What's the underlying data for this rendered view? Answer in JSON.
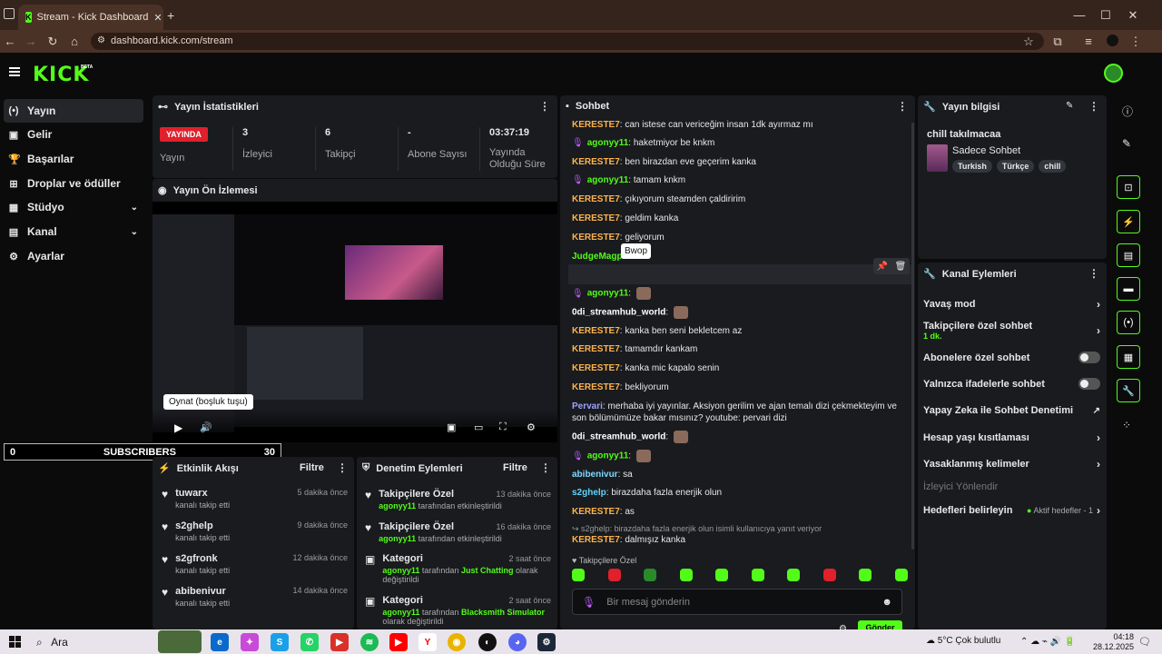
{
  "browser": {
    "tab_title": "Stream - Kick Dashboard",
    "url": "dashboard.kick.com/stream"
  },
  "brand": {
    "logo": "KICK",
    "beta": "BETA",
    "accent": "#53fc18"
  },
  "sidebar": {
    "items": [
      {
        "label": "Yayın",
        "icon": "broadcast-icon"
      },
      {
        "label": "Gelir",
        "icon": "wallet-icon"
      },
      {
        "label": "Başarılar",
        "icon": "trophy-icon"
      },
      {
        "label": "Droplar ve ödüller",
        "icon": "gift-icon"
      },
      {
        "label": "Stüdyo",
        "icon": "studio-icon"
      },
      {
        "label": "Kanal",
        "icon": "channel-icon"
      },
      {
        "label": "Ayarlar",
        "icon": "gear-icon"
      }
    ]
  },
  "stats": {
    "title": "Yayın İstatistikleri",
    "live_badge": "YAYINDA",
    "items": [
      {
        "value": "",
        "label": "Yayın"
      },
      {
        "value": "3",
        "label": "İzleyici"
      },
      {
        "value": "6",
        "label": "Takipçi"
      },
      {
        "value": "-",
        "label": "Abone Sayısı"
      },
      {
        "value": "03:37:19",
        "label": "Yayında Olduğu Süre"
      }
    ]
  },
  "preview": {
    "title": "Yayın Ön İzlemesi",
    "tooltip": "Oynat (boşluk tuşu)"
  },
  "subscribers": {
    "left": "0",
    "label": "SUBSCRIBERS",
    "right": "30"
  },
  "activity": {
    "title": "Etkinlik Akışı",
    "filter": "Filtre",
    "items": [
      {
        "name": "tuwarx",
        "desc": "kanalı takip etti",
        "time": "5 dakika önce"
      },
      {
        "name": "s2ghelp",
        "desc": "kanalı takip etti",
        "time": "9 dakika önce"
      },
      {
        "name": "s2gfronk",
        "desc": "kanalı takip etti",
        "time": "12 dakika önce"
      },
      {
        "name": "abibenivur",
        "desc": "kanalı takip etti",
        "time": "14 dakika önce"
      }
    ]
  },
  "moderation": {
    "title": "Denetim Eylemleri",
    "filter": "Filtre",
    "items": [
      {
        "title": "Takipçilere Özel",
        "user": "agonyy11",
        "rest": "tarafından etkinleştirildi",
        "time": "13 dakika önce"
      },
      {
        "title": "Takipçilere Özel",
        "user": "agonyy11",
        "rest": "tarafından etkinleştirildi",
        "time": "16 dakika önce"
      },
      {
        "title": "Kategori",
        "user": "agonyy11",
        "mid": "tarafından",
        "cat": "Just Chatting",
        "rest": "olarak değiştirildi",
        "time": "2 saat önce"
      },
      {
        "title": "Kategori",
        "user": "agonyy11",
        "mid": "tarafından",
        "cat": "Blacksmith Simulator",
        "rest": "olarak değiştirildi",
        "time": "2 saat önce"
      }
    ]
  },
  "chat": {
    "title": "Sohbet",
    "tooltip": "Bwop",
    "messages": [
      {
        "user": "KERESTE7",
        "cls": "k",
        "text": "can istese can vericeğim insan 1dk ayırmaz mı"
      },
      {
        "user": "agonyy11",
        "cls": "a",
        "mic": true,
        "text": "haketmiyor be knkm"
      },
      {
        "user": "KERESTE7",
        "cls": "k",
        "text": "ben birazdan eve geçerim kanka"
      },
      {
        "user": "agonyy11",
        "cls": "a",
        "mic": true,
        "text": "tamam knkm"
      },
      {
        "user": "KERESTE7",
        "cls": "k",
        "text": "çıkıyorum steamden çaldiririm"
      },
      {
        "user": "KERESTE7",
        "cls": "k",
        "text": "geldim kanka"
      },
      {
        "user": "KERESTE7",
        "cls": "k",
        "text": "geliyorum"
      },
      {
        "user": "JudgeMagpi",
        "cls": "j",
        "text": ""
      },
      {
        "user": "agonyy11",
        "cls": "a",
        "mic": true,
        "text": ""
      },
      {
        "user": "agonyy11",
        "cls": "a",
        "mic": true,
        "text": ""
      },
      {
        "user": "0di_streamhub_world",
        "cls": "o",
        "text": ""
      },
      {
        "user": "KERESTE7",
        "cls": "k",
        "text": "kanka ben seni bekletcem az"
      },
      {
        "user": "KERESTE7",
        "cls": "k",
        "text": "tamamdır kankam"
      },
      {
        "user": "KERESTE7",
        "cls": "k",
        "text": "kanka mic kapalo senin"
      },
      {
        "user": "KERESTE7",
        "cls": "k",
        "text": "bekliyorum"
      },
      {
        "user": "Pervari",
        "cls": "p",
        "text": "merhaba iyi yayınlar. Aksiyon gerilim ve ajan temalı dizi çekmekteyim ve son bölümümüze bakar mısınız? youtube: pervari dizi"
      },
      {
        "user": "0di_streamhub_world",
        "cls": "o",
        "text": ""
      },
      {
        "user": "agonyy11",
        "cls": "a",
        "mic": true,
        "text": ""
      },
      {
        "user": "abibenivur",
        "cls": "ab",
        "text": "sa"
      },
      {
        "user": "s2ghelp",
        "cls": "s",
        "text": "birazdaha fazla enerjik olun"
      },
      {
        "user": "KERESTE7",
        "cls": "k",
        "text": "as"
      }
    ],
    "reply_note": "s2ghelp: birazdaha fazla enerjik olun isimli kullanıcıya yanıt veriyor",
    "last": {
      "user": "KERESTE7",
      "text": "dalmışız kanka"
    },
    "followers_only": "Takipçilere Özel",
    "placeholder": "Bir mesaj gönderin",
    "send": "Gönder"
  },
  "stream_info": {
    "title": "Yayın bilgisi",
    "stream_title": "chill takılmacaa",
    "category": "Sadece Sohbet",
    "tags": [
      "Turkish",
      "Türkçe",
      "chill"
    ]
  },
  "channel_actions": {
    "title": "Kanal Eylemleri",
    "items": [
      {
        "label": "Yavaş mod",
        "type": "arrow"
      },
      {
        "label": "Takipçilere özel sohbet",
        "sub": "1 dk.",
        "type": "arrow"
      },
      {
        "label": "Abonelere özel sohbet",
        "type": "toggle"
      },
      {
        "label": "Yalnızca ifadelerle sohbet",
        "type": "toggle"
      },
      {
        "label": "Yapay Zeka ile Sohbet Denetimi",
        "type": "ext"
      },
      {
        "label": "Hesap yaşı kısıtlaması",
        "type": "arrow"
      },
      {
        "label": "Yasaklanmış kelimeler",
        "type": "arrow"
      },
      {
        "label": "İzleyici Yönlendir",
        "type": "dim"
      },
      {
        "label": "Hedefleri belirleyin",
        "extra": "Aktif hedefler - 1",
        "type": "arrow"
      }
    ]
  },
  "taskbar": {
    "search": "Ara",
    "weather": "5°C  Çok bulutlu",
    "time": "04:18",
    "date": "28.12.2025"
  }
}
